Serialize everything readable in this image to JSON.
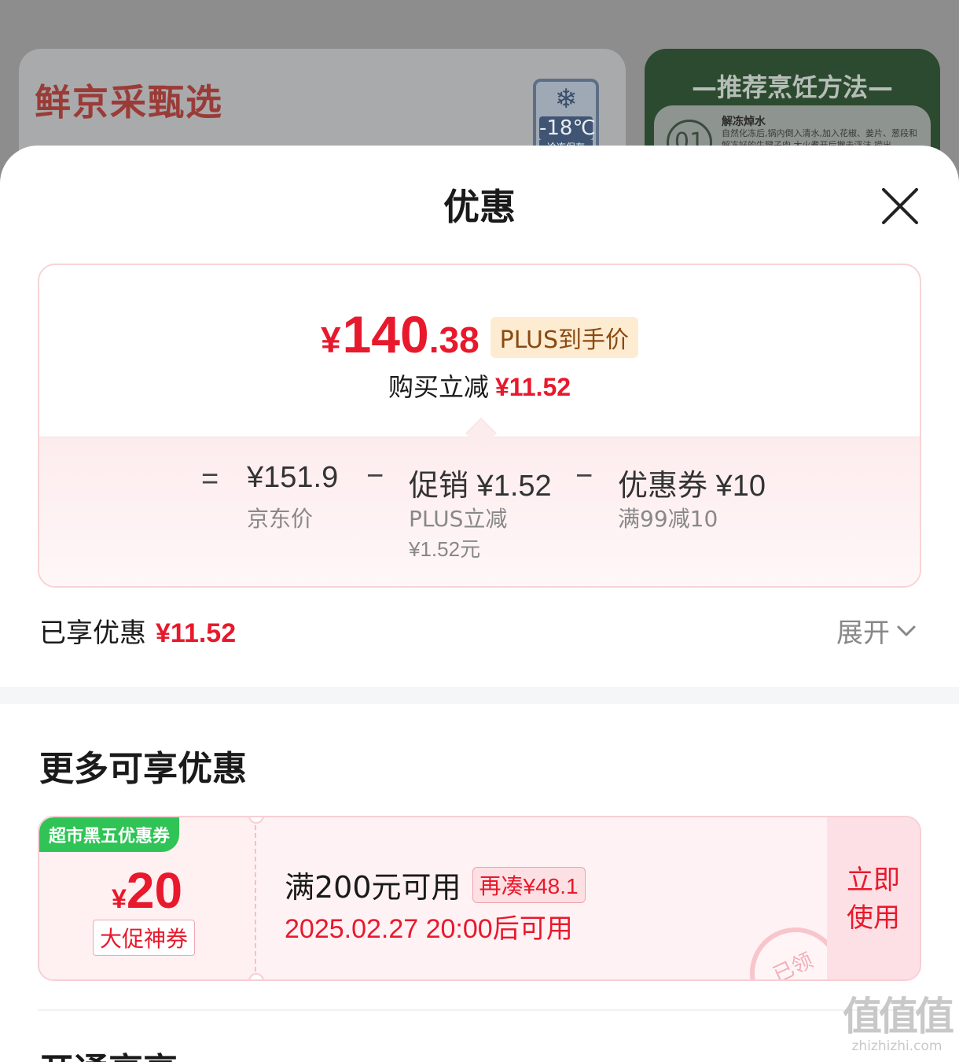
{
  "background": {
    "brand": "鲜京采甄选",
    "freeze_temp": "-18℃",
    "freeze_caption": "冷冻保存",
    "method_title": "—推荐烹饪方法—",
    "step_no": "01",
    "step_name": "解冻焯水",
    "step_text": "自然化冻后,锅内倒入清水,加入花椒、姜片、葱段和解冻好的牛腱子肉,大火煮开后撇去浮沫,捞出"
  },
  "sheet": {
    "title": "优惠",
    "close_icon": "close-icon"
  },
  "price": {
    "yen": "¥",
    "integer": "140",
    "decimal": ".38",
    "tag": "PLUS到手价",
    "reduce_label": "购买立减",
    "reduce_amount": "¥11.52",
    "formula": {
      "equals": "=",
      "jd_price": "¥151.9",
      "jd_price_label": "京东价",
      "minus1": "−",
      "promo": "促销 ¥1.52",
      "promo_desc": "PLUS立减",
      "promo_desc2": "¥1.52元",
      "minus2": "−",
      "coupon": "优惠券 ¥10",
      "coupon_desc": "满99减10"
    }
  },
  "enjoyed": {
    "label": "已享优惠",
    "amount": "¥11.52",
    "expand": "展开"
  },
  "more": {
    "title": "更多可享优惠",
    "coupon": {
      "badge": "超市黑五优惠券",
      "yen": "¥",
      "value": "20",
      "type": "大促神券",
      "condition": "满200元可用",
      "gap": "再凑¥48.1",
      "time": "2025.02.27 20:00后可用",
      "stamp": "已领",
      "action": "立即使用"
    }
  },
  "next_section": {
    "title": "开通享享"
  },
  "watermark": {
    "logo": "值值值",
    "site": "zhizhizhi.com"
  },
  "colors": {
    "accent": "#e8192c",
    "green": "#2fc455",
    "plus_bg": "#fdecd2"
  }
}
